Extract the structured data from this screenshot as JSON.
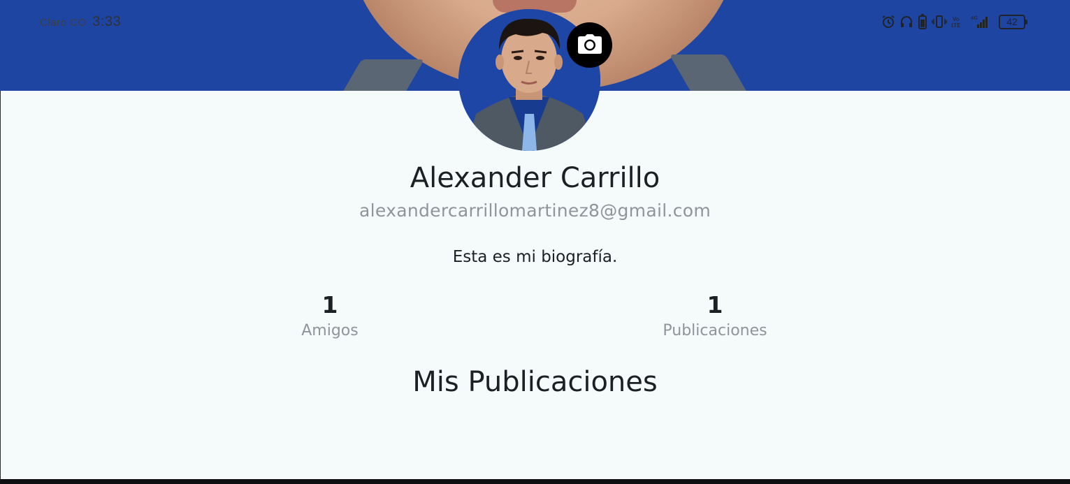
{
  "status_bar": {
    "carrier": "Claro CO",
    "time": "3:33",
    "battery": "42",
    "icons": [
      "alarm-icon",
      "headphones-icon",
      "battery-saver-icon",
      "vibrate-icon",
      "volte-icon",
      "signal-icon",
      "battery-icon"
    ]
  },
  "profile": {
    "name": "Alexander Carrillo",
    "email": "alexandercarrillomartinez8@gmail.com",
    "bio": "Esta es mi biografía.",
    "camera_icon": "camera-icon"
  },
  "stats": {
    "friends": {
      "value": "1",
      "label": "Amigos"
    },
    "posts": {
      "value": "1",
      "label": "Publicaciones"
    }
  },
  "section": {
    "title": "Mis Publicaciones"
  },
  "colors": {
    "cover": "#1f45a3",
    "background": "#f5fafb",
    "muted_text": "#8f959b"
  }
}
